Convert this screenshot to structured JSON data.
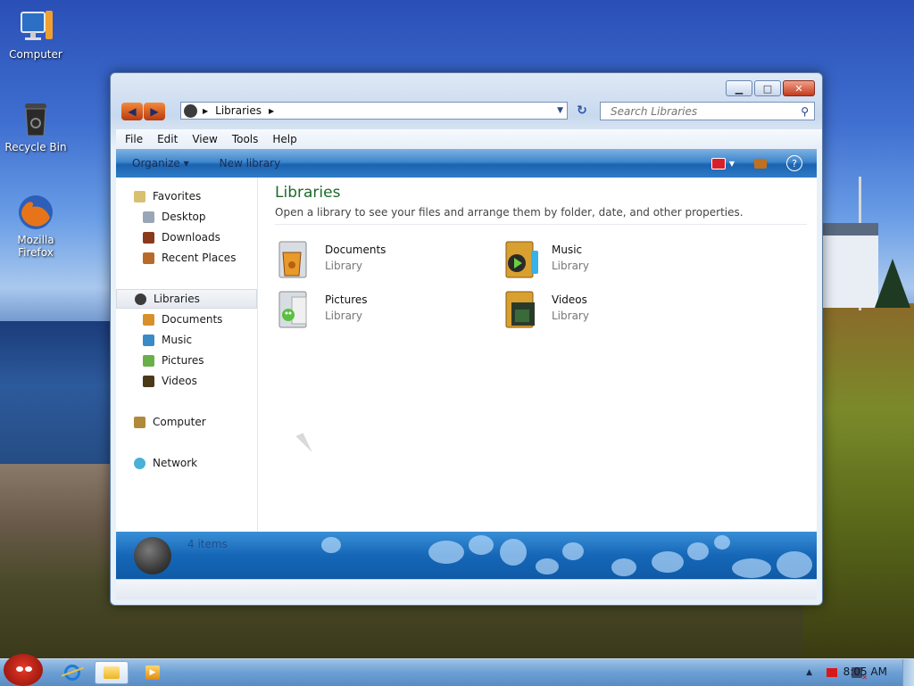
{
  "desktop": {
    "icons": [
      {
        "label": "Computer"
      },
      {
        "label": "Recycle Bin"
      },
      {
        "label": "Mozilla\nFirefox"
      }
    ]
  },
  "window": {
    "address": {
      "crumb": "Libraries"
    },
    "search": {
      "placeholder": "Search Libraries"
    },
    "menu": [
      "File",
      "Edit",
      "View",
      "Tools",
      "Help"
    ],
    "toolbar": {
      "organize": "Organize ▾",
      "new_library": "New library",
      "help": "?"
    },
    "nav": {
      "favorites": "Favorites",
      "favorites_items": [
        "Desktop",
        "Downloads",
        "Recent Places"
      ],
      "libraries": "Libraries",
      "libraries_items": [
        "Documents",
        "Music",
        "Pictures",
        "Videos"
      ],
      "computer": "Computer",
      "network": "Network"
    },
    "main": {
      "title": "Libraries",
      "subtitle": "Open a library to see your files and arrange them by folder, date, and other properties.",
      "libraries": [
        {
          "name": "Documents",
          "type": "Library"
        },
        {
          "name": "Music",
          "type": "Library"
        },
        {
          "name": "Pictures",
          "type": "Library"
        },
        {
          "name": "Videos",
          "type": "Library"
        }
      ]
    },
    "details": {
      "count": "4 items"
    }
  },
  "taskbar": {
    "clock": "8:05 AM"
  },
  "colors": {
    "accent": "#1667b8",
    "title_green": "#1d6a2a",
    "close_red": "#c23b1c"
  }
}
